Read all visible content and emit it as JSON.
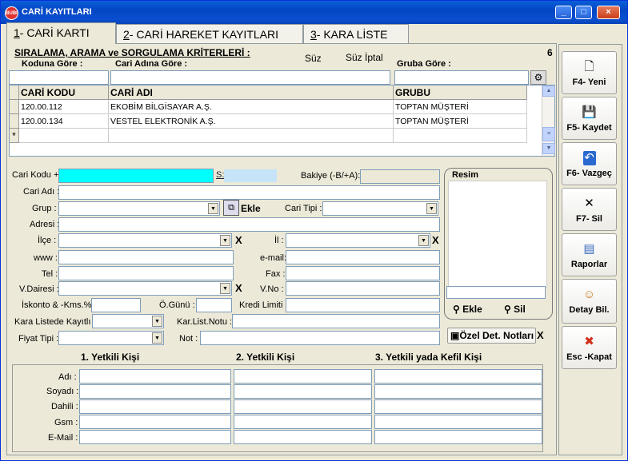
{
  "window": {
    "title": "CARİ KAYITLARI",
    "logo": "BUBI",
    "min": "_",
    "max": "□",
    "close": "×"
  },
  "tabs": [
    {
      "num": "1",
      "label": "- CARİ KARTI"
    },
    {
      "num": "2",
      "label": "- CARİ HAREKET KAYITLARI"
    },
    {
      "num": "3",
      "label": "- KARA LİSTE"
    }
  ],
  "search": {
    "header": "SIRALAMA, ARAMA ve SORGULAMA KRİTERLERİ :",
    "suz": "Süz",
    "suz_iptal": "Süz İptal",
    "count": "6",
    "by_code": "Koduna Göre :",
    "by_name": "Cari Adına Göre :",
    "by_group": "Gruba Göre :"
  },
  "grid": {
    "headers": [
      "CARİ KODU",
      "CARİ ADI",
      "GRUBU"
    ],
    "rows": [
      [
        "120.00.112",
        "EKOBİM BİLGİSAYAR A.Ş.",
        "TOPTAN MÜŞTERİ"
      ],
      [
        "120.00.134",
        "VESTEL ELEKTRONİK A.Ş.",
        "TOPTAN MÜŞTERİ"
      ]
    ],
    "new_row": "*"
  },
  "form": {
    "cari_kodu": "Cari Kodu +",
    "s": "S:",
    "bakiye": "Bakiye (-B/+A):",
    "cari_adi": "Cari Adı :",
    "grup": "Grup :",
    "ekle": "Ekle",
    "cari_tipi": "Cari Tipi :",
    "adresi": "Adresi :",
    "ilce": "İlçe :",
    "il": "İl :",
    "www": "www :",
    "email": "e-mail:",
    "tel": "Tel :",
    "fax": "Fax :",
    "vdairesi": "V.Dairesi :",
    "vno": "V.No :",
    "iskonto": "İskonto & -Kms.%:",
    "ogunu": "Ö.Günü :",
    "kredi": "Kredi Limiti :",
    "kara_liste": "Kara Listede Kayıtlı :",
    "kar_list_notu": "Kar.List.Notu :",
    "fiyat_tipi": "Fiyat Tipi :",
    "not": "Not :",
    "x": "X"
  },
  "resim": {
    "title": "Resim",
    "ekle": "Ekle",
    "sil": "Sil"
  },
  "ozel": "Özel Det. Notları",
  "yetkili": {
    "headers": [
      "1. Yetkili Kişi",
      "2. Yetkili Kişi",
      "3. Yetkili yada Kefil Kişi"
    ],
    "rows": [
      "Adı :",
      "Soyadı :",
      "Dahili :",
      "Gsm :",
      "E-Mail :"
    ]
  },
  "sidebar": [
    {
      "label": "F4- Yeni",
      "icon": "new-doc-icon",
      "glyph": "🗋"
    },
    {
      "label": "F5- Kaydet",
      "icon": "save-icon",
      "glyph": "💾"
    },
    {
      "label": "F6- Vazgeç",
      "icon": "undo-icon",
      "glyph": "↶"
    },
    {
      "label": "F7- Sil",
      "icon": "delete-icon",
      "glyph": "✕"
    },
    {
      "label": "Raporlar",
      "icon": "report-icon",
      "glyph": "▤"
    },
    {
      "label": "Detay Bil.",
      "icon": "detail-icon",
      "glyph": "☺"
    },
    {
      "label": "Esc -Kapat",
      "icon": "close-circle-icon",
      "glyph": "✖"
    }
  ],
  "colors": {
    "code_field": "#00ffff",
    "s_field": "#c6e4f7",
    "title_blue": "#0a5fd8"
  }
}
